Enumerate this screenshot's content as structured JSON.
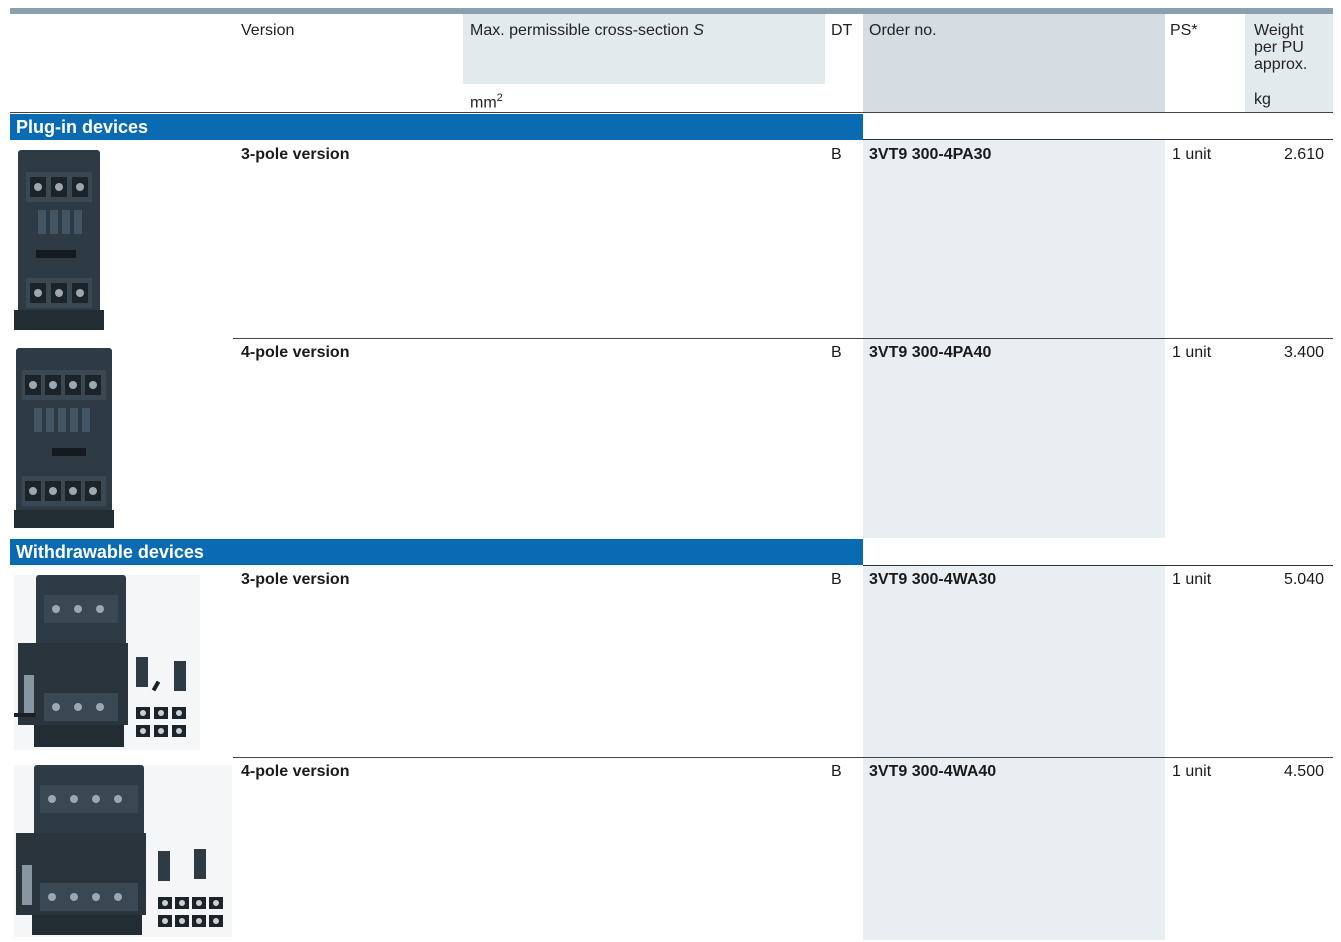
{
  "header": {
    "version": "Version",
    "cross_section": "Max. permissible cross-section",
    "cross_section_symbol": "S",
    "cross_section_unit": "mm",
    "cross_section_unit_exp": "2",
    "dt": "DT",
    "order_no": "Order no.",
    "ps": "PS*",
    "weight_l1": "Weight",
    "weight_l2": "per PU",
    "weight_l3": "approx.",
    "weight_unit": "kg"
  },
  "sections": [
    {
      "title": "Plug-in devices",
      "rows": [
        {
          "version": "3-pole version",
          "dt": "B",
          "order": "3VT9 300-4PA30",
          "ps": "1 unit",
          "weight": "2.610",
          "image": "plug-in-base-3-pole"
        },
        {
          "version": "4-pole version",
          "dt": "B",
          "order": "3VT9 300-4PA40",
          "ps": "1 unit",
          "weight": "3.400",
          "image": "plug-in-base-4-pole"
        }
      ]
    },
    {
      "title": "Withdrawable devices",
      "rows": [
        {
          "version": "3-pole version",
          "dt": "B",
          "order": "3VT9 300-4WA30",
          "ps": "1 unit",
          "weight": "5.040",
          "image": "withdrawable-kit-3-pole"
        },
        {
          "version": "4-pole version",
          "dt": "B",
          "order": "3VT9 300-4WA40",
          "ps": "1 unit",
          "weight": "4.500",
          "image": "withdrawable-kit-4-pole"
        }
      ]
    }
  ],
  "colors": {
    "section_bar": "#0a6bb3",
    "order_shade": "#e8eef1",
    "header_shade": "#e3eaee",
    "device_body": "#2e3a44"
  }
}
